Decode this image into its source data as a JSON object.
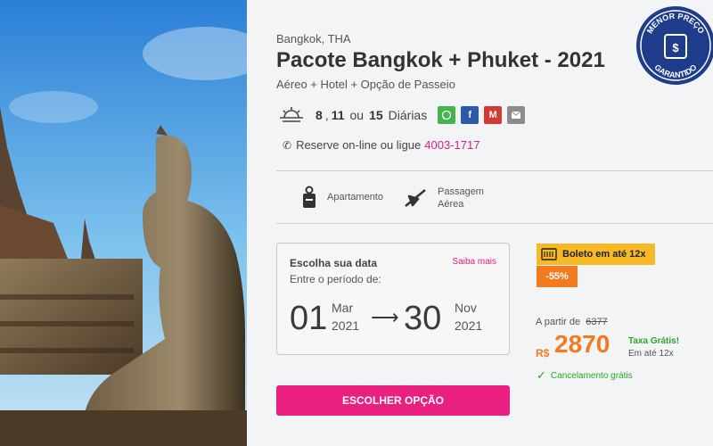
{
  "hero": {
    "image": "buddha-statue-photo"
  },
  "badge": {
    "line1": "MENOR PREÇO",
    "line2": "GARANTIDO",
    "icon": "money-icon",
    "color": "#1f3c8a"
  },
  "package": {
    "location": "Bangkok, THA",
    "title": "Pacote Bangkok + Phuket - 2021",
    "subtitle": "Aéreo + Hotel + Opção de Passeio"
  },
  "nights": {
    "n1": "8",
    "sep1": " ,",
    "n2": "11",
    "sep2": "ou",
    "n3": "15",
    "label": "Diárias"
  },
  "share": {
    "whatsapp": "whatsapp-icon",
    "facebook": "f",
    "gmail": "M",
    "email": "email-icon"
  },
  "contact": {
    "text": "Reserve on-line ou ligue",
    "phone": "4003-1717"
  },
  "features": [
    {
      "icon": "door-hanger-icon",
      "label": "Apartamento"
    },
    {
      "icon": "airplane-icon",
      "label_line1": "Passagem",
      "label_line2": "Aérea"
    }
  ],
  "dates": {
    "label": "Escolha sua data",
    "more": "Saiba mais",
    "period": "Entre o período de:",
    "start": {
      "day": "01",
      "month": "Mar",
      "year": "2021"
    },
    "end": {
      "day": "30",
      "month": "Nov",
      "year": "2021"
    }
  },
  "payment": {
    "boleto": "Boleto em até 12x",
    "discount": "-55%",
    "from_label": "A partir de",
    "old_price": "6377",
    "currency": "R$",
    "price": "2870",
    "tax": "Taxa Grátis!",
    "installments": "Em até 12x",
    "cancel": "Cancelamento grátis"
  },
  "cta": {
    "label": "ESCOLHER OPÇÃO",
    "color": "#e9207f"
  }
}
